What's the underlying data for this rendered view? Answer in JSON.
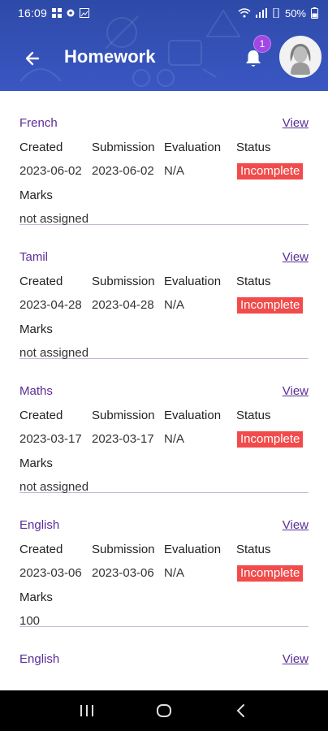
{
  "status_bar": {
    "time": "16:09",
    "battery": "50%"
  },
  "header": {
    "title": "Homework",
    "notification_count": "1",
    "accent_color": "#3a57c3"
  },
  "columns": {
    "created": "Created",
    "submission": "Submission",
    "evaluation": "Evaluation",
    "status": "Status",
    "marks": "Marks"
  },
  "view_label": "View",
  "homework": [
    {
      "subject": "French",
      "created": "2023-06-02",
      "submission": "2023-06-02",
      "evaluation": "N/A",
      "status": "Incomplete",
      "marks": "not assigned"
    },
    {
      "subject": "Tamil",
      "created": "2023-04-28",
      "submission": "2023-04-28",
      "evaluation": "N/A",
      "status": "Incomplete",
      "marks": "not assigned"
    },
    {
      "subject": "Maths",
      "created": "2023-03-17",
      "submission": "2023-03-17",
      "evaluation": "N/A",
      "status": "Incomplete",
      "marks": "not assigned"
    },
    {
      "subject": "English",
      "created": "2023-03-06",
      "submission": "2023-03-06",
      "evaluation": "N/A",
      "status": "Incomplete",
      "marks": "100"
    },
    {
      "subject": "English"
    }
  ],
  "icons": {
    "back": "arrow-left-icon",
    "bell": "bell-icon",
    "avatar": "user-avatar",
    "nav_recents": "recents-icon",
    "nav_home": "home-icon",
    "nav_back": "chevron-left-icon"
  },
  "colors": {
    "incomplete": "#f24b4b",
    "link": "#5a2d97",
    "badge": "#a246e4"
  }
}
